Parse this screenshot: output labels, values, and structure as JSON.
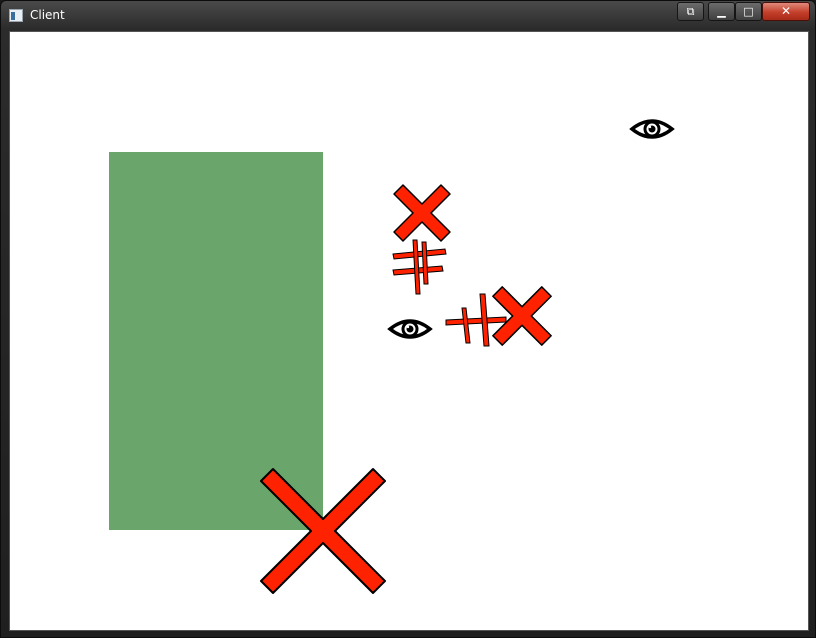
{
  "window": {
    "title": "Client",
    "icon": "application-icon",
    "controls": {
      "extra": "restore-to-tray-icon",
      "minimize": "minimize-icon",
      "maximize": "maximize-icon",
      "close": "close-icon",
      "close_color": "#c9402b"
    }
  },
  "scene": {
    "background_color": "#ffffff",
    "rectangle_color": "#6aa56c",
    "cross_color": "#ff2200",
    "stroke_color": "#000000",
    "eye_icon": "eye-icon",
    "cross_icon": "x-cross-icon"
  }
}
